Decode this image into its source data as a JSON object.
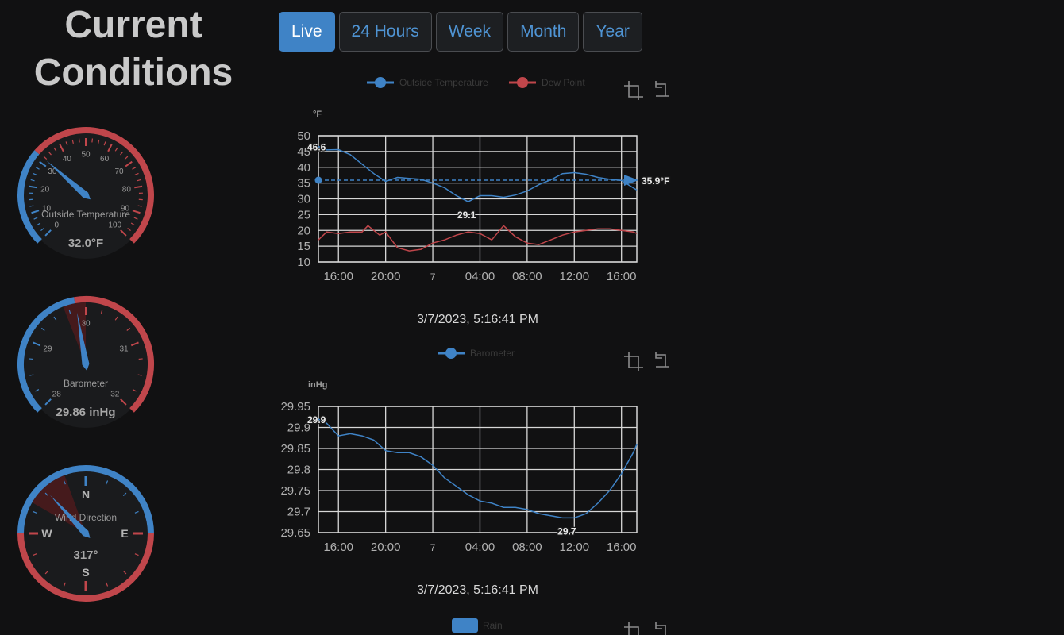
{
  "header": {
    "title": "Current Conditions"
  },
  "tabs": [
    {
      "label": "Live",
      "active": true
    },
    {
      "label": "24 Hours",
      "active": false
    },
    {
      "label": "Week",
      "active": false
    },
    {
      "label": "Month",
      "active": false
    },
    {
      "label": "Year",
      "active": false
    }
  ],
  "colors": {
    "blue": "#3f83c6",
    "red": "#c0464b",
    "needle": "#3f83c6",
    "background": "#111112",
    "grid": "#d7d7d7",
    "tab_text": "#4f94d4"
  },
  "icons": [
    "zoom-box-icon",
    "restore-icon"
  ],
  "gauges": [
    {
      "label": "Outside Temperature",
      "value_text": "32.0°F",
      "value": 32.0,
      "min": 0,
      "max": 100,
      "major_ticks": [
        0,
        10,
        20,
        30,
        40,
        50,
        60,
        70,
        80,
        90,
        100
      ],
      "cold_max": 32
    },
    {
      "label": "Barometer",
      "value_text": "29.86 inHg",
      "value": 29.86,
      "min": 28,
      "max": 32,
      "major_ticks": [
        28,
        29,
        30,
        31,
        32
      ],
      "range_low": 29.86,
      "range_high": 30.0
    },
    {
      "label": "Wind Direction",
      "value_text": "317°",
      "value": 317,
      "cardinals": [
        "N",
        "E",
        "S",
        "W"
      ],
      "range_low": 300,
      "range_high": 340
    }
  ],
  "chart_data": [
    {
      "type": "line",
      "unit_label": "°F",
      "legend": [
        "Outside Temperature",
        "Dew Point"
      ],
      "x_ticks": [
        "16:00",
        "20:00",
        "7",
        "04:00",
        "08:00",
        "12:00",
        "16:00"
      ],
      "x_tick_hours": [
        16,
        20,
        24,
        28,
        32,
        36,
        40
      ],
      "xlim": [
        14.3,
        41.3
      ],
      "ylim": [
        10,
        50
      ],
      "y_ticks": [
        "10",
        "15",
        "20",
        "25",
        "30",
        "35",
        "40",
        "45",
        "50"
      ],
      "series": [
        {
          "name": "Outside Temperature",
          "x": [
            14.3,
            15,
            16,
            17,
            18,
            19,
            20,
            21,
            22,
            23,
            24,
            25,
            26,
            27,
            28,
            29,
            30,
            31,
            32,
            33,
            34,
            35,
            36,
            37,
            38,
            39,
            40,
            41,
            41.3
          ],
          "y": [
            46.6,
            45.5,
            45.6,
            44,
            41,
            38,
            35.5,
            36.8,
            36.5,
            36.2,
            35,
            33.5,
            31,
            29.1,
            31,
            31,
            30.5,
            31.2,
            32.5,
            34.5,
            36,
            38,
            38.3,
            37.8,
            36.8,
            36.2,
            35.8,
            33.5,
            32.8
          ]
        },
        {
          "name": "Dew Point",
          "x": [
            14.3,
            15,
            16,
            17,
            18,
            18.5,
            19,
            19.5,
            20,
            20.5,
            21,
            22,
            23,
            24,
            25,
            26,
            27,
            28,
            29,
            30,
            31,
            32,
            33,
            34,
            35,
            36,
            37,
            38,
            39,
            40,
            41,
            41.3
          ],
          "y": [
            17,
            19.5,
            19,
            19.5,
            19.5,
            21.5,
            20,
            18.5,
            19.5,
            17,
            14.5,
            13.5,
            14,
            16,
            17,
            18.5,
            19.5,
            19,
            17,
            21.5,
            18,
            16,
            15.5,
            17,
            18.5,
            19.5,
            20,
            20.5,
            20.5,
            20,
            19.5,
            19
          ]
        }
      ],
      "current_value": 35.9,
      "current_label": "35.9°F",
      "max_label": "46.6",
      "max_point": [
        14.3,
        46.6
      ],
      "min_label": "29.1",
      "min_point": [
        27,
        29.1
      ]
    },
    {
      "type": "line",
      "unit_label": "inHg",
      "legend": [
        "Barometer"
      ],
      "x_ticks": [
        "16:00",
        "20:00",
        "7",
        "04:00",
        "08:00",
        "12:00",
        "16:00"
      ],
      "x_tick_hours": [
        16,
        20,
        24,
        28,
        32,
        36,
        40
      ],
      "xlim": [
        14.3,
        41.3
      ],
      "ylim": [
        29.65,
        29.95
      ],
      "y_ticks": [
        "29.65",
        "29.7",
        "29.75",
        "29.8",
        "29.85",
        "29.9",
        "29.95"
      ],
      "series": [
        {
          "name": "Barometer",
          "x": [
            14.3,
            15,
            16,
            17,
            18,
            19,
            20,
            21,
            22,
            23,
            24,
            25,
            26,
            27,
            28,
            29,
            30,
            31,
            32,
            33,
            34,
            35,
            36,
            37,
            38,
            39,
            40,
            41,
            41.3
          ],
          "y": [
            29.92,
            29.91,
            29.88,
            29.885,
            29.88,
            29.87,
            29.845,
            29.84,
            29.84,
            29.83,
            29.81,
            29.78,
            29.76,
            29.74,
            29.725,
            29.72,
            29.71,
            29.71,
            29.705,
            29.695,
            29.69,
            29.685,
            29.685,
            29.695,
            29.72,
            29.75,
            29.79,
            29.84,
            29.86
          ]
        }
      ],
      "max_label": "29.9",
      "max_point": [
        14.3,
        29.92
      ],
      "min_label": "29.7",
      "min_point": [
        35.5,
        29.685
      ]
    }
  ],
  "timestamps": [
    "3/7/2023, 5:16:41 PM",
    "3/7/2023, 5:16:41 PM"
  ],
  "rain_legend": "Rain"
}
